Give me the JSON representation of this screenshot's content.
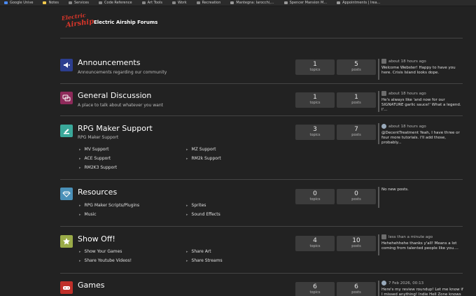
{
  "bookmarks": [
    {
      "label": "Google Unive",
      "color": "#4a8af4"
    },
    {
      "label": "Notes",
      "color": "#f2c94c"
    },
    {
      "label": "Services",
      "color": "#888888"
    },
    {
      "label": "Code Reference",
      "color": "#888888"
    },
    {
      "label": "Art Tools",
      "color": "#888888"
    },
    {
      "label": "Work",
      "color": "#888888"
    },
    {
      "label": "Recreation",
      "color": "#888888"
    },
    {
      "label": "Mantegna: Iarocchi,...",
      "color": "#999999"
    },
    {
      "label": "Spencer Mansion M...",
      "color": "#999999"
    },
    {
      "label": "Appointments | Irea...",
      "color": "#999999"
    }
  ],
  "header": {
    "logo_line1": "Electric",
    "logo_line2": "Airship",
    "site_title": "Electric Airship Forums"
  },
  "forums": [
    {
      "title": "Announcements",
      "description": "Announcements regarding our community",
      "icon": "megaphone-icon",
      "icon_color": "#2c3e8f",
      "topics": "1",
      "topics_label": "topics",
      "posts": "5",
      "posts_label": "posts",
      "last_when": "about 18 hours ago",
      "last_msg": "Welcome Webster! Happy to have you here. Crisis Island looks dope.",
      "subforums": []
    },
    {
      "title": "General Discussion",
      "description": "A place to talk about whatever you want",
      "icon": "chat-bubbles-icon",
      "icon_color": "#8e2a5a",
      "topics": "1",
      "topics_label": "topics",
      "posts": "1",
      "posts_label": "posts",
      "last_when": "about 18 hours ago",
      "last_msg": "He's always like 'and now for our SIGNATURE garlic sauce!' What a legend. I'...",
      "subforums": []
    },
    {
      "title": "RPG Maker Support",
      "description": "RPG Maker Support",
      "icon": "tools-icon",
      "icon_color": "#3aa89a",
      "topics": "3",
      "topics_label": "topics",
      "posts": "7",
      "posts_label": "posts",
      "last_when": "about 18 hours ago",
      "last_msg": "@DecentTreatment Yeah, I have three or four more tutorials. I'll add those, probably...",
      "subforums": [
        "MV Support",
        "MZ Support",
        "ACE Support",
        "RM2k Support",
        "RM2K3 Support"
      ]
    },
    {
      "title": "Resources",
      "description": "",
      "icon": "diamond-icon",
      "icon_color": "#4a90b8",
      "topics": "0",
      "topics_label": "topics",
      "posts": "0",
      "posts_label": "posts",
      "last_when": "",
      "last_msg": "No new posts.",
      "subforums": [
        "RPG Maker Scripts/Plugins",
        "Sprites",
        "Music",
        "Sound Effects"
      ]
    },
    {
      "title": "Show Off!",
      "description": "",
      "icon": "star-icon",
      "icon_color": "#9aab48",
      "topics": "4",
      "topics_label": "topics",
      "posts": "10",
      "posts_label": "posts",
      "last_when": "less than a minute ago",
      "last_msg": "Hehehehhehe thanks y'all! Means a lot coming from talented people like you....",
      "subforums": [
        "Show Your Games",
        "Share Art",
        "Share Youtube Videos!",
        "Share Streams"
      ]
    },
    {
      "title": "Games",
      "description": "",
      "icon": "gamepad-icon",
      "icon_color": "#c0302a",
      "topics": "6",
      "topics_label": "topics",
      "posts": "6",
      "posts_label": "posts",
      "last_when": "7 Feb 2026, 00:13",
      "last_msg": "Here's my review roundup! Let me know if I missed anything! Indie Hell Zone knows wh...",
      "subforums": []
    }
  ]
}
